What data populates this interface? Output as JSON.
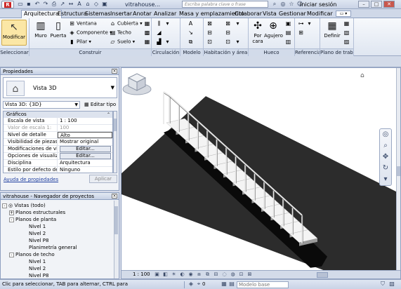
{
  "title_bar": {
    "document_title": "vitrahouse...",
    "search_placeholder": "Escriba palabra clave o frase",
    "signin_label": "Iniciar sesión"
  },
  "ribbon_tabs": [
    "Arquitectura",
    "Estructura",
    "Sistemas",
    "Insertar",
    "Anotar",
    "Analizar",
    "Masa y emplazamiento",
    "Colaborar",
    "Vista",
    "Gestionar",
    "Modificar"
  ],
  "ribbon": {
    "modify_label": "Modificar",
    "build": {
      "wall_label": "Muro",
      "door_label": "Puerta",
      "window_label": "Ventana",
      "component_label": "Componente",
      "column_label": "Pilar",
      "roof_label": "Cubierta",
      "ceiling_label": "Techo",
      "floor_label": "Suelo"
    },
    "opening": {
      "by_face_label": "Por cara",
      "shaft_label": "Agujero"
    },
    "datum": {
      "set_label": "Definir"
    },
    "groups": [
      "Seleccionar",
      "Construir",
      "Circulación",
      "Modelo",
      "Habitación y área",
      "Hueco",
      "Referencia",
      "Plano de trabajo"
    ]
  },
  "properties": {
    "header": "Propiedades",
    "type_name": "Vista 3D",
    "instance_selector": "Vista 3D: {3D}",
    "edit_type_label": "Editar tipo",
    "category": "Gráficos",
    "rows": [
      {
        "key": "Escala de vista",
        "value": "1 : 100"
      },
      {
        "key": "Valor de escala   1:",
        "value": "100"
      },
      {
        "key": "Nivel de detalle",
        "value": "Alto"
      },
      {
        "key": "Visibilidad de piezas",
        "value": "Mostrar original"
      },
      {
        "key": "Modificaciones de visi...",
        "value": "Editar..."
      },
      {
        "key": "Opciones de visualiza...",
        "value": "Editar..."
      },
      {
        "key": "Disciplina",
        "value": "Arquitectura"
      },
      {
        "key": "Estilo por defecto de v...",
        "value": "Ninguno"
      }
    ],
    "help_link": "Ayuda de propiedades",
    "apply_label": "Aplicar"
  },
  "project_browser": {
    "header": "vitrahouse - Navegador de proyectos",
    "items": [
      {
        "label": "Vistas (todo)",
        "level": 0,
        "toggle": "-"
      },
      {
        "label": "Planos estructurales",
        "level": 1,
        "toggle": "+"
      },
      {
        "label": "Planos de planta",
        "level": 1,
        "toggle": "-"
      },
      {
        "label": "Nivel 1",
        "level": 2,
        "toggle": ""
      },
      {
        "label": "Nivel 2",
        "level": 2,
        "toggle": ""
      },
      {
        "label": "Nivel P8",
        "level": 2,
        "toggle": ""
      },
      {
        "label": "Planimetría general",
        "level": 2,
        "toggle": ""
      },
      {
        "label": "Planos de techo",
        "level": 1,
        "toggle": "-"
      },
      {
        "label": "Nivel 1",
        "level": 2,
        "toggle": ""
      },
      {
        "label": "Nivel 2",
        "level": 2,
        "toggle": ""
      },
      {
        "label": "Nivel P8",
        "level": 2,
        "toggle": ""
      }
    ]
  },
  "view": {
    "scale": "1 : 100",
    "stair_steps": 14
  },
  "status_bar": {
    "hint": "Clic para seleccionar, TAB para alternar, CTRL para",
    "counter": "0",
    "level_placeholder": "Modelo base"
  },
  "colors": {
    "floor": "#2c2c2c",
    "stair_shadow": "#0a0a0a",
    "accent": "#fbe7a6"
  }
}
